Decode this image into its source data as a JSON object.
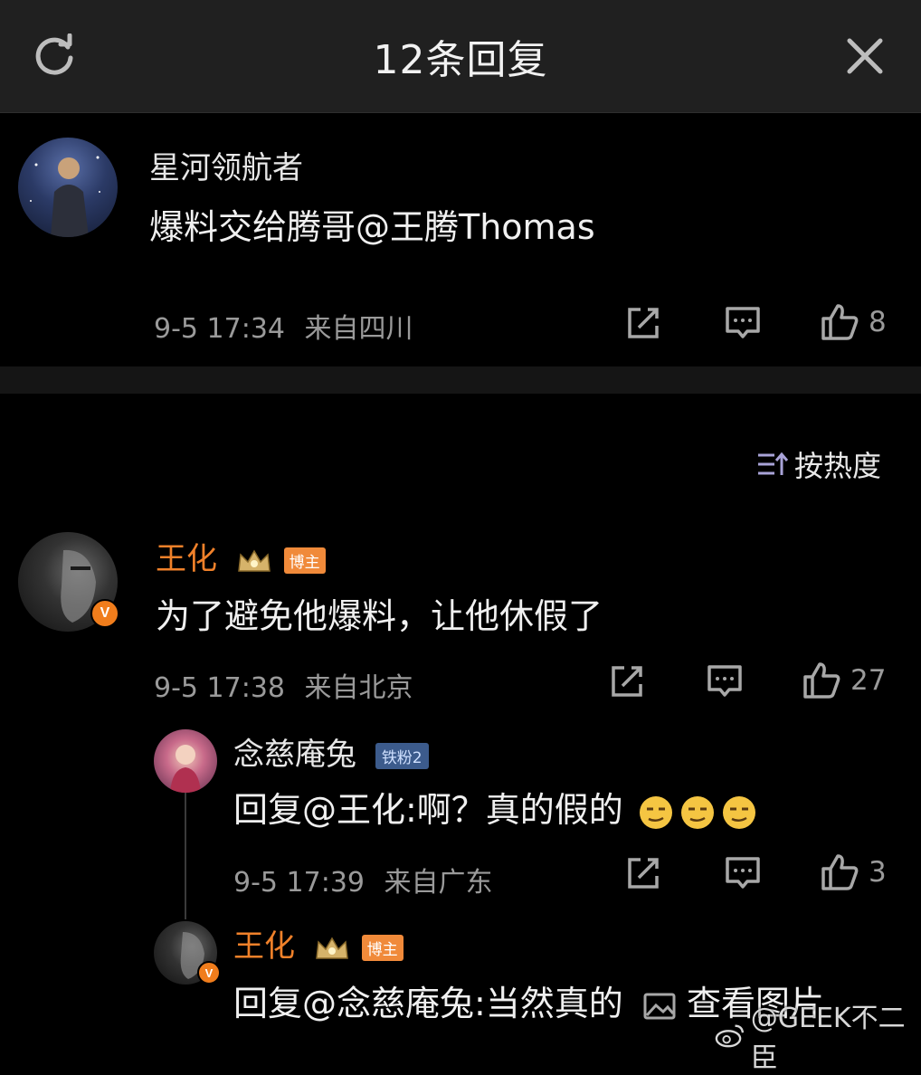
{
  "header": {
    "title": "12条回复"
  },
  "root_comment": {
    "username": "星河领航者",
    "text": "爆料交给腾哥@王腾Thomas",
    "time": "9-5 17:34",
    "location": "来自四川",
    "likes": "8"
  },
  "sort": {
    "label": "按热度"
  },
  "replies": [
    {
      "username": "王化",
      "badge": "博主",
      "text": "为了避免他爆料，让他休假了",
      "time": "9-5 17:38",
      "location": "来自北京",
      "likes": "27",
      "verified_badge": "V"
    },
    {
      "username": "念慈庵兔",
      "badge": "铁粉2",
      "text": "回复@王化:啊？真的假的",
      "time": "9-5 17:39",
      "location": "来自广东",
      "likes": "3"
    },
    {
      "username": "王化",
      "badge": "博主",
      "text": "回复@念慈庵兔:当然真的",
      "link": "查看图片",
      "verified_badge": "V"
    }
  ],
  "watermark": "@GEEK不二臣",
  "colors": {
    "background": "#000000",
    "header": "#202020",
    "accent_orange": "#f0812a",
    "meta_gray": "#9a9a9a"
  },
  "icons": [
    "refresh-icon",
    "close-icon",
    "share-icon",
    "comment-icon",
    "like-icon",
    "sort-icon",
    "crown-icon",
    "image-icon",
    "weibo-logo-icon"
  ]
}
